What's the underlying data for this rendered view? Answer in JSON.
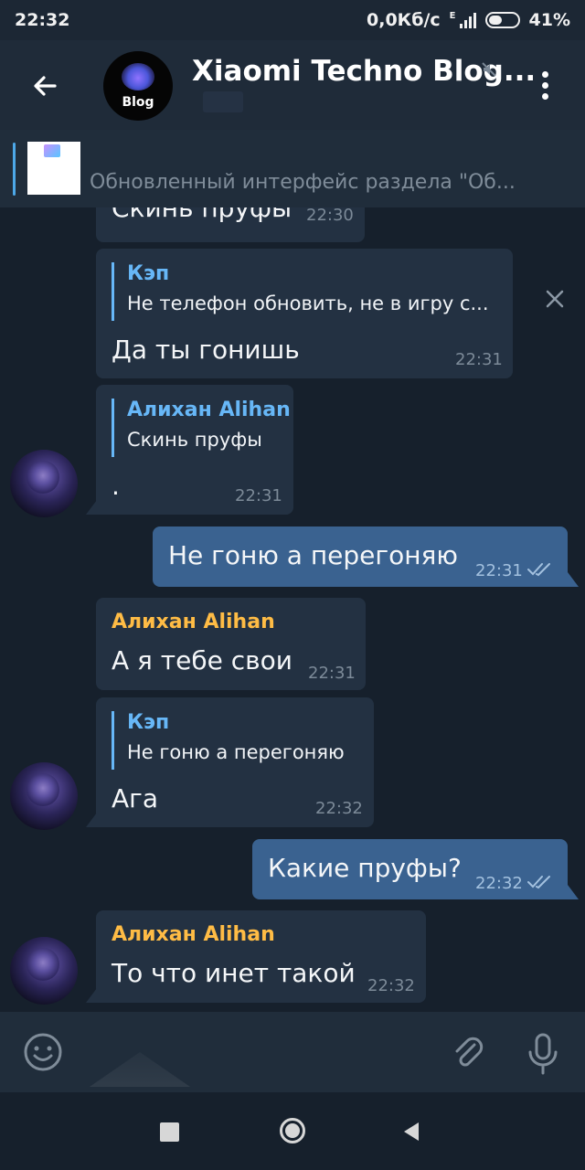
{
  "status_bar": {
    "time": "22:32",
    "speed": "0,0Кб/с",
    "network_label": "E",
    "battery": "41%"
  },
  "header": {
    "title": "Xiaomi Techno Blog...",
    "avatar_label": "Blog"
  },
  "pinned": {
    "text": "Обновленный интерфейс раздела \"Об..."
  },
  "messages": [
    {
      "id": "m1",
      "direction": "in",
      "text": "Скинь пруфы",
      "time": "22:30"
    },
    {
      "id": "m2",
      "direction": "in",
      "reply_author": "Кэп",
      "reply_text": "Не телефон обновить, не в игру с...",
      "text": "Да ты гонишь",
      "time": "22:31"
    },
    {
      "id": "m3",
      "direction": "in",
      "reply_author": "Алихан Alihan",
      "reply_text": "Скинь пруфы",
      "text": ".",
      "time": "22:31"
    },
    {
      "id": "m4",
      "direction": "out",
      "text": "Не гоню а перегоняю",
      "time": "22:31",
      "read": true
    },
    {
      "id": "m5",
      "direction": "in",
      "sender": "Алихан Alihan",
      "text": "А я тебе свои",
      "time": "22:31"
    },
    {
      "id": "m6",
      "direction": "in",
      "reply_author": "Кэп",
      "reply_text": "Не гоню а перегоняю",
      "text": "Ага",
      "time": "22:32"
    },
    {
      "id": "m7",
      "direction": "out",
      "text": "Какие пруфы?",
      "time": "22:32",
      "read": true
    },
    {
      "id": "m8",
      "direction": "in",
      "sender": "Алихан Alihan",
      "text": "То что инет такой",
      "time": "22:32"
    }
  ],
  "icons": {
    "back": "back-arrow-icon",
    "mute": "muted-speaker-icon",
    "menu": "more-vertical-icon",
    "close": "close-icon",
    "smile": "emoji-icon",
    "attach": "paperclip-icon",
    "mic": "microphone-icon",
    "read": "double-check-icon"
  },
  "colors": {
    "background": "#16202c",
    "header": "#1f2b39",
    "incoming_bubble": "#233142",
    "outgoing_bubble": "#3a6290",
    "accent": "#67b7f7",
    "sender_name": "#ffbc45"
  }
}
